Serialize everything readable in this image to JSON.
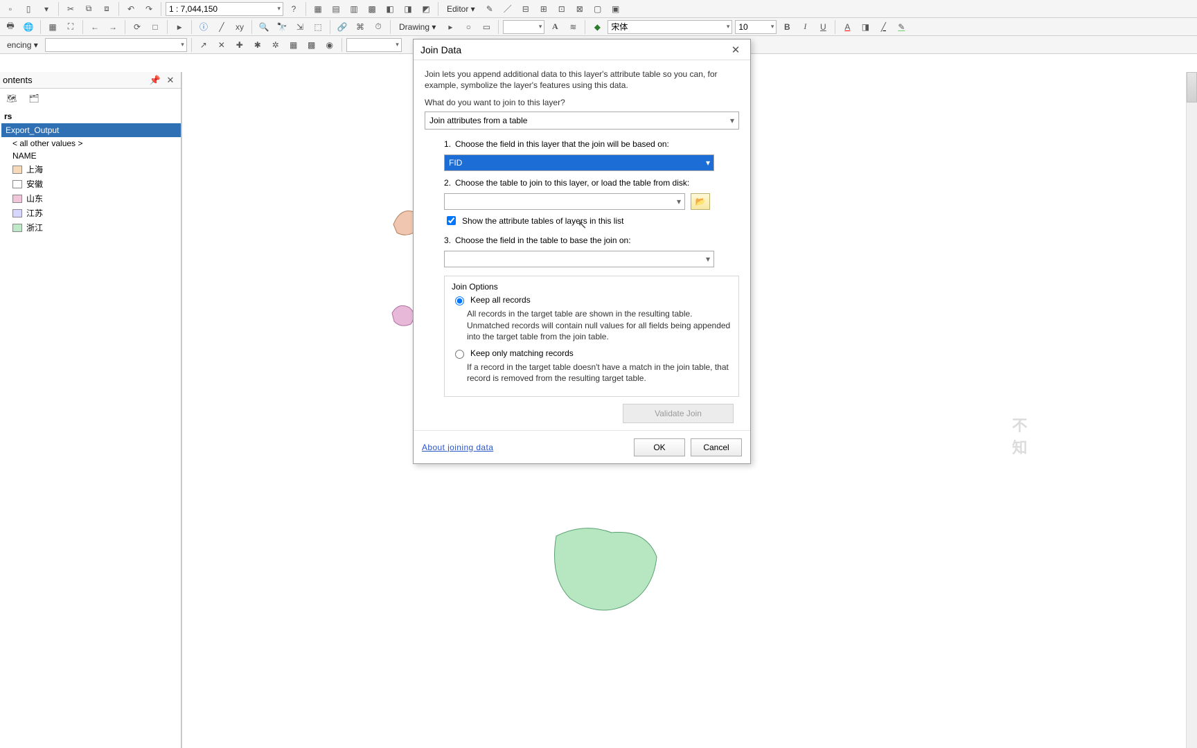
{
  "toolbars": {
    "scale": "1 : 7,044,150",
    "editor_label": "Editor ▾",
    "drawing_label": "Drawing ▾",
    "font_name": "宋体",
    "font_size": "10",
    "referencing_label": "encing ▾"
  },
  "panel": {
    "title": "ontents",
    "layers_header": "rs",
    "selected_layer": "Export_Output",
    "all_other": "< all other values >",
    "name_field": "NAME",
    "items": [
      {
        "label": "上海",
        "color": "#f6d9b8"
      },
      {
        "label": "安徽",
        "color": "#ffffff"
      },
      {
        "label": "山东",
        "color": "#f1c6db"
      },
      {
        "label": "江苏",
        "color": "#d6d6ff"
      },
      {
        "label": "浙江",
        "color": "#bfe8c8"
      }
    ]
  },
  "dialog": {
    "title": "Join Data",
    "intro": "Join lets you append additional data to this layer's attribute table so you can, for example, symbolize the layer's features using this data.",
    "question": "What do you want to join to this layer?",
    "join_method": "Join attributes from a table",
    "step1_label": "Choose the field in this layer that the join will be based on:",
    "step1_value": "FID",
    "step2_label": "Choose the table to join to this layer, or load the table from disk:",
    "step2_value": "",
    "step2_show_attr": "Show the attribute tables of layers in this list",
    "step2_show_attr_checked": true,
    "step3_label": "Choose the field in the table to base the join on:",
    "step3_value": "",
    "options_title": "Join Options",
    "opt1_label": "Keep all records",
    "opt1_desc": "All records in the target table are shown in the resulting table. Unmatched records will contain null values for all fields being appended into the target table from the join table.",
    "opt2_label": "Keep only matching records",
    "opt2_desc": "If a record in the target table doesn't have a match in the join table, that record is removed from the resulting target table.",
    "validate": "Validate Join",
    "about_link": "About joining data",
    "ok": "OK",
    "cancel": "Cancel"
  }
}
